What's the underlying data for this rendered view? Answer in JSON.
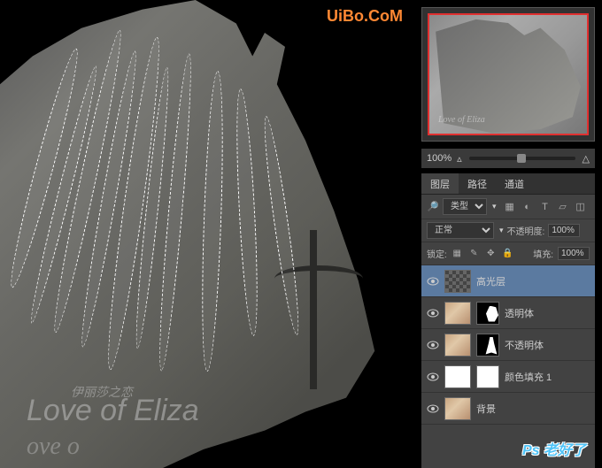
{
  "canvas": {
    "watermark_small": "伊丽莎之恋",
    "watermark_main": "Love of Eliza",
    "watermark_cut": "ove o",
    "site_watermark": "UiBo.CoM"
  },
  "navigator": {
    "zoom_value": "100%",
    "nav_label": "Love of Eliza"
  },
  "panels": {
    "tab_layers": "图层",
    "tab_paths": "路径",
    "tab_channels": "通道",
    "filter_type": "类型",
    "blend_mode": "正常",
    "opacity_label": "不透明度:",
    "opacity_value": "100%",
    "lock_label": "锁定:",
    "fill_label": "填充:",
    "fill_value": "100%"
  },
  "layers": [
    {
      "name": "高光层",
      "selected": true,
      "thumb": "checker",
      "mask": null
    },
    {
      "name": "透明体",
      "selected": false,
      "thumb": "photo",
      "mask": "m1"
    },
    {
      "name": "不透明体",
      "selected": false,
      "thumb": "photo",
      "mask": "m2"
    },
    {
      "name": "颜色填充 1",
      "selected": false,
      "thumb": "white",
      "mask": "white"
    },
    {
      "name": "背景",
      "selected": false,
      "thumb": "photo",
      "mask": null
    }
  ],
  "logo": "Ps 老好了"
}
